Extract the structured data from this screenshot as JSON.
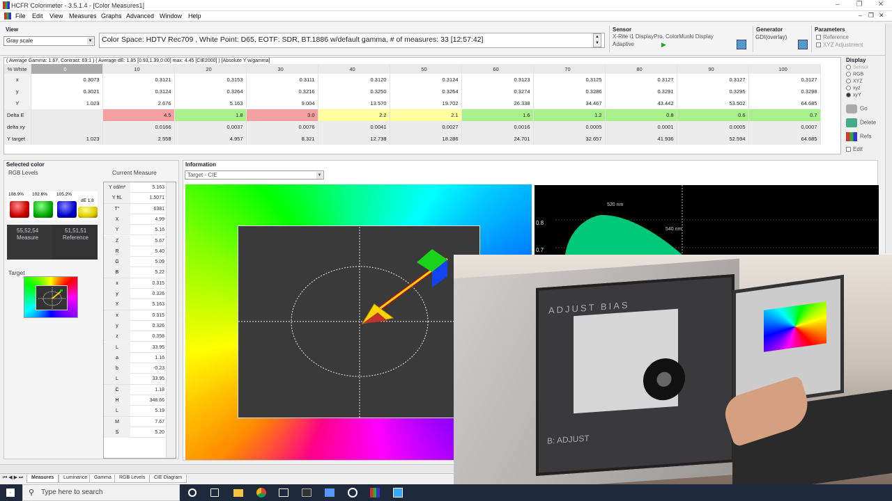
{
  "window": {
    "title": "HCFR Colorimeter - 3.5.1.4 - [Color Measures1]"
  },
  "menu": [
    "File",
    "Edit",
    "View",
    "Measures",
    "Graphs",
    "Advanced",
    "Window",
    "Help"
  ],
  "view": {
    "label": "View",
    "select_value": "Gray scale",
    "info_text": "Color Space: HDTV Rec709 , White Point: D65, EOTF:  SDR, BT.1886 w/default gamma, # of measures: 33 [12:57:42]"
  },
  "sensor": {
    "label": "Sensor",
    "device": "X-Rite i1 DisplayPro, ColorMunki Display",
    "mode": "Adaptive"
  },
  "generator": {
    "label": "Generator",
    "value": "GDI(overlay)"
  },
  "parameters": {
    "label": "Parameters",
    "opt1": "Reference",
    "opt2": "XYZ Adjustment"
  },
  "table": {
    "caption": "( Average Gamma: 1.67, Contrast: 63:1 ) ( Average dE: 1.85 [0.93,1.39,0.00] max: 4.45 [CIE2000] ) [Absolute Y w/gamma]",
    "columns": [
      "0",
      "10",
      "20",
      "30",
      "40",
      "50",
      "60",
      "70",
      "80",
      "90",
      "100"
    ],
    "head_label": "% White",
    "rows": [
      {
        "label": "x",
        "values": [
          "0.3073",
          "0.3121",
          "0.3153",
          "0.3111",
          "0.3120",
          "0.3124",
          "0.3123",
          "0.3125",
          "0.3127",
          "0.3127",
          "0.3127"
        ]
      },
      {
        "label": "y",
        "values": [
          "0.3021",
          "0.3124",
          "0.3264",
          "0.3216",
          "0.3250",
          "0.3264",
          "0.3274",
          "0.3286",
          "0.3291",
          "0.3295",
          "0.3298"
        ]
      },
      {
        "label": "Y",
        "values": [
          "1.023",
          "2.676",
          "5.163",
          "9.004",
          "13.570",
          "19.702",
          "26.338",
          "34.467",
          "43.442",
          "53.502",
          "64.685"
        ]
      },
      {
        "label": "Delta E",
        "values": [
          "",
          "4.5",
          "1.8",
          "3.0",
          "2.2",
          "2.1",
          "1.6",
          "1.2",
          "0.8",
          "0.6",
          "0.7"
        ]
      },
      {
        "label": "delta xy",
        "values": [
          "",
          "0.0166",
          "0.0037",
          "0.0076",
          "0.0041",
          "0.0027",
          "0.0016",
          "0.0005",
          "0.0001",
          "0.0005",
          "0.0007"
        ]
      },
      {
        "label": "Y target",
        "values": [
          "1.023",
          "2.558",
          "4.957",
          "8.321",
          "12.738",
          "18.286",
          "24.701",
          "32.657",
          "41.936",
          "52.594",
          "64.685"
        ]
      }
    ]
  },
  "display": {
    "label": "Display",
    "options": [
      "Sensor",
      "RGB",
      "XYZ",
      "xyz",
      "xyY"
    ],
    "buttons": [
      "Go",
      "Delete",
      "Refs"
    ],
    "edit": "Edit"
  },
  "selected": {
    "label": "Selected color",
    "rgb_levels": "RGB Levels",
    "current_measure": "Current Measure",
    "pct_r": "108.9%",
    "pct_g": "102.6%",
    "pct_b": "105.2%",
    "de": "dE 1.8",
    "measure_rgb": "55,52,54",
    "measure_label": "Measure",
    "ref_rgb": "51,51,51",
    "ref_label": "Reference",
    "target_label": "Target",
    "measure_rows": [
      {
        "k": "Y cd/m²",
        "v": "5.163"
      },
      {
        "k": "Y ftL",
        "v": "1.5071"
      },
      {
        "k": "T°",
        "v": "6381"
      },
      {
        "k": "X",
        "v": "4.99"
      },
      {
        "k": "Y",
        "v": "5.16"
      },
      {
        "k": "Z",
        "v": "5.67"
      },
      {
        "k": "R",
        "v": "5.40"
      },
      {
        "k": "G",
        "v": "5.09"
      },
      {
        "k": "B",
        "v": "5.22"
      },
      {
        "k": "x",
        "v": "0.315"
      },
      {
        "k": "y",
        "v": "0.326"
      },
      {
        "k": "Y",
        "v": "5.163"
      },
      {
        "k": "x",
        "v": "0.315"
      },
      {
        "k": "y",
        "v": "0.326"
      },
      {
        "k": "z",
        "v": "0.358"
      },
      {
        "k": "L",
        "v": "33.95"
      },
      {
        "k": "a",
        "v": "1.16"
      },
      {
        "k": "b",
        "v": "-0.23"
      },
      {
        "k": "L",
        "v": "33.95"
      },
      {
        "k": "C",
        "v": "1.18"
      },
      {
        "k": "H",
        "v": "348.66"
      },
      {
        "k": "L",
        "v": "5.19"
      },
      {
        "k": "M",
        "v": "7.67"
      },
      {
        "k": "S",
        "v": "5.20"
      }
    ]
  },
  "information": {
    "label": "Information",
    "select_value": "Target - CIE",
    "spectrum": {
      "tick_08": "0.8",
      "tick_07": "0.7",
      "wl1": "520 nm",
      "wl2": "540 nm"
    }
  },
  "photo": {
    "screen_text1": "ADJUST BIAS",
    "screen_text2": "B: ADJUST"
  },
  "tabs": [
    "Measures",
    "Luminance",
    "Gamma",
    "RGB Levels",
    "CIE Diagram"
  ],
  "taskbar": {
    "search_placeholder": "Type here to search"
  }
}
